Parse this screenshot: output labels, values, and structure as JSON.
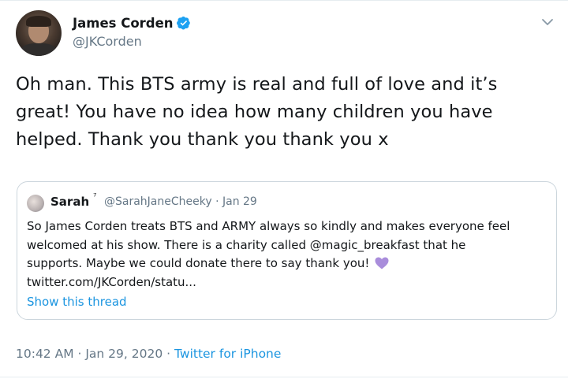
{
  "author": {
    "display_name": "James Corden",
    "handle": "@JKCorden",
    "verified": true
  },
  "tweet": {
    "text": "Oh man. This BTS army is real and full of love and it’s great! You have no idea how many children you have helped. Thank you thank you thank you x"
  },
  "quoted_tweet": {
    "display_name": "Sarah",
    "name_suffix": "⁷",
    "handle_and_date": "@SarahJaneCheeky · Jan 29",
    "text_line1": "So James Corden treats BTS and ARMY always so kindly and makes everyone feel",
    "text_line2": "welcomed at his show. There is a charity called @magic_breakfast that he",
    "text_line3": "supports. Maybe we could donate there to say thank you!",
    "text_line4": "twitter.com/JKCorden/statu...",
    "emoji": "purple-heart",
    "show_thread_label": "Show this thread"
  },
  "meta": {
    "time_date": "10:42 AM · Jan 29, 2020 · ",
    "source": "Twitter for iPhone"
  },
  "colors": {
    "link": "#1b95e0",
    "secondary_text": "#657786",
    "verified_badge": "#1da1f2",
    "heart": "#a98ddb",
    "border": "#ccd6dd"
  },
  "icons": [
    "verified-badge-icon",
    "chevron-down-icon",
    "purple-heart-icon"
  ]
}
